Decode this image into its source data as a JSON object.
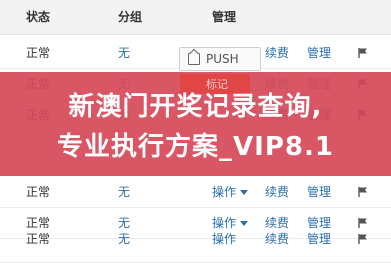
{
  "header": {
    "status": "状态",
    "group": "分组",
    "manage": "管理"
  },
  "push_button": {
    "label": "PUSH"
  },
  "red_button": {
    "label": "标记"
  },
  "rows": [
    {
      "status": "正常",
      "group": "无",
      "action": "",
      "renew": "续费",
      "manage": "管理"
    },
    {
      "status": "正常",
      "group": "无",
      "action": "",
      "renew": "续费",
      "manage": "管理"
    },
    {
      "status": "正常",
      "group": "无",
      "action": "",
      "renew": "续费",
      "manage": "管理"
    },
    {
      "status": "正常",
      "group": "无",
      "action": "操作",
      "renew": "续费",
      "manage": "管理"
    },
    {
      "status": "正常",
      "group": "无",
      "action": "操作",
      "renew": "续费",
      "manage": "管理"
    },
    {
      "status": "正常",
      "group": "无",
      "action": "操作",
      "renew": "续费",
      "manage": "管理"
    }
  ],
  "banner": {
    "line1": "新澳门开奖记录查询,",
    "line2": "专业执行方案_VIP8.1"
  },
  "colors": {
    "banner_bg": "#d64858",
    "link": "#2a6fb0",
    "header_bg": "#f3f3f3"
  }
}
